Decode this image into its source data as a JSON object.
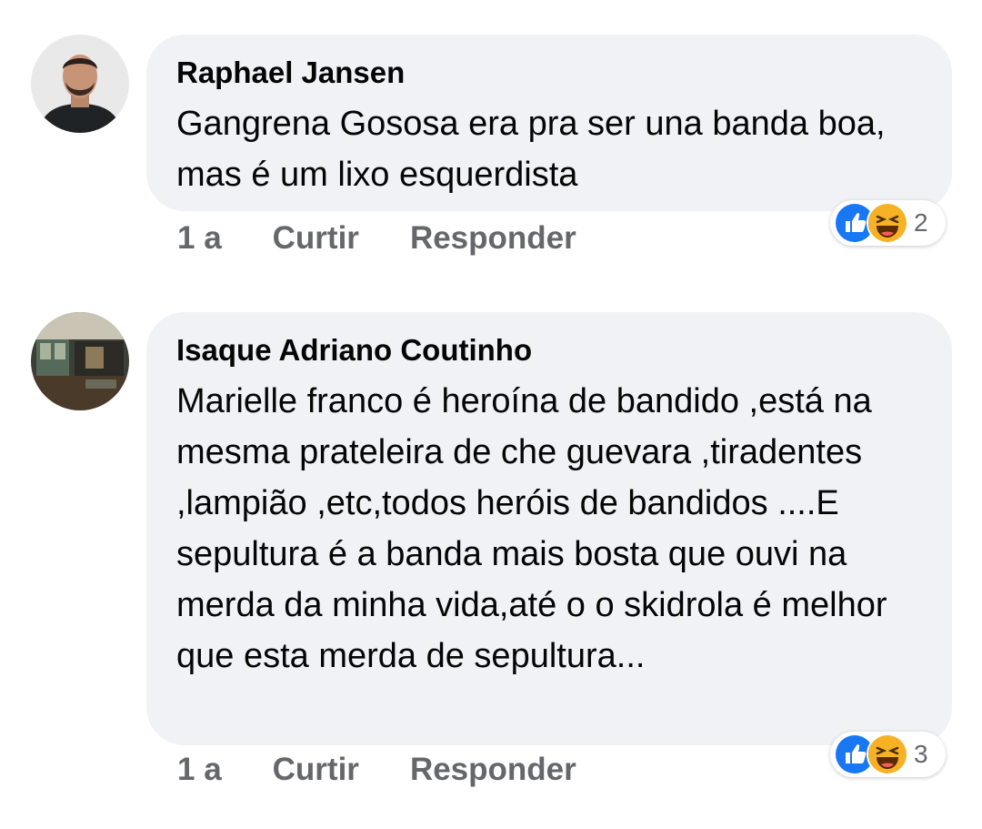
{
  "colors": {
    "bubble_bg": "#f0f2f5",
    "meta_text": "#65676b",
    "like_blue": "#1877f2",
    "haha_yellow": "#f7b125"
  },
  "comments": [
    {
      "author": "Raphael Jansen",
      "text": "Gangrena Gososa era pra ser una banda boa, mas é um lixo esquerdista",
      "time": "1 a",
      "like_label": "Curtir",
      "reply_label": "Responder",
      "reactions": [
        "like-icon",
        "haha-icon"
      ],
      "reaction_count": "2"
    },
    {
      "author": "Isaque Adriano Coutinho",
      "text": "Marielle franco é heroína de bandido ,está na mesma prateleira de che guevara ,tiradentes ,lampião ,etc,todos heróis de bandidos ....E sepultura é a banda mais bosta que ouvi na merda da minha vida,até o o skidrola é melhor que esta merda de sepultura...",
      "time": "1 a",
      "like_label": "Curtir",
      "reply_label": "Responder",
      "reactions": [
        "like-icon",
        "haha-icon"
      ],
      "reaction_count": "3"
    }
  ]
}
